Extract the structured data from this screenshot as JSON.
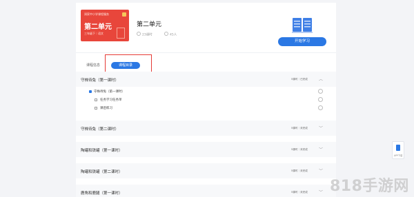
{
  "cover": {
    "series_text": "润家中小学课程服务",
    "title": "第二单元",
    "subtitle": "三年级下｜语文"
  },
  "lesson": {
    "title": "第二单元",
    "lessons_count": "23课时",
    "learners": "45人"
  },
  "actions": {
    "start_label": "开始学习"
  },
  "tabs": [
    {
      "label": "课程信息",
      "active": false
    },
    {
      "label": "课程目录",
      "active": true
    }
  ],
  "sections": [
    {
      "title": "守株待兔（第一课时）",
      "meta": "5课时｜已完成",
      "expanded": true,
      "items": [
        {
          "label": "守株待兔（第一课时）",
          "type": "video"
        },
        {
          "label": "任务学习任务单",
          "type": "doc"
        },
        {
          "label": "课后练习",
          "type": "doc"
        }
      ]
    },
    {
      "title": "守株待兔（第二课时）",
      "meta": "5课时｜未完成",
      "expanded": false
    },
    {
      "title": "陶罐和铁罐（第一课时）",
      "meta": "5课时｜未完成",
      "expanded": false
    },
    {
      "title": "陶罐和铁罐（第二课时）",
      "meta": "5课时｜未完成",
      "expanded": false
    },
    {
      "title": "鹿角和鹿腿（第一课时）",
      "meta": "5课时｜未完成",
      "expanded": false
    }
  ],
  "app_download": {
    "label": "APP下载"
  },
  "watermark": "818手游网",
  "colors": {
    "accent": "#2b78e4",
    "cover": "#e8463b",
    "highlight": "#e53935"
  }
}
